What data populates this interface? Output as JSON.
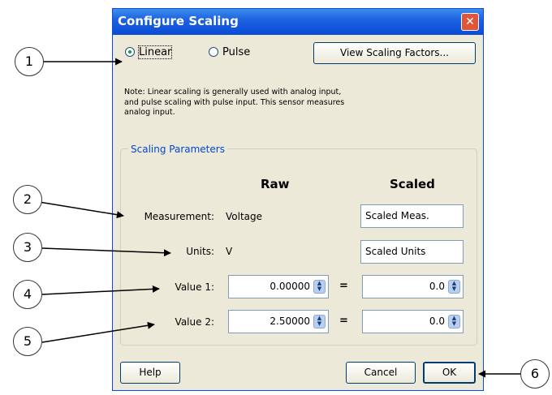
{
  "dialog": {
    "title": "Configure Scaling",
    "close_symbol": "✕",
    "radio_linear": "Linear",
    "radio_pulse": "Pulse",
    "selected_mode": "Linear",
    "view_factors_button": "View Scaling Factors...",
    "note_line1": "Note: Linear scaling is generally used with analog input,",
    "note_line2": "and pulse scaling with pulse input. This sensor measures",
    "note_line3": "analog input.",
    "group_title": "Scaling Parameters",
    "col_raw": "Raw",
    "col_scaled": "Scaled",
    "measurement_label": "Measurement:",
    "measurement_raw": "Voltage",
    "measurement_scaled": "Scaled Meas.",
    "units_label": "Units:",
    "units_raw": "V",
    "units_scaled": "Scaled Units",
    "value1_label": "Value 1:",
    "value1_raw": "0.00000",
    "value1_scaled": "0.0",
    "value2_label": "Value 2:",
    "value2_raw": "2.50000",
    "value2_scaled": "0.0",
    "equals": "=",
    "help_button": "Help",
    "cancel_button": "Cancel",
    "ok_button": "OK"
  },
  "callouts": [
    "1",
    "2",
    "3",
    "4",
    "5",
    "6"
  ],
  "icons": {
    "close": "close-icon",
    "spin": "spin-arrows-icon",
    "radio": "radio-icon"
  },
  "colors": {
    "title_bar": "#0a4bd6",
    "dialog_bg": "#ece9d8",
    "group_title": "#0046d5",
    "close_btn": "#e0553a"
  }
}
